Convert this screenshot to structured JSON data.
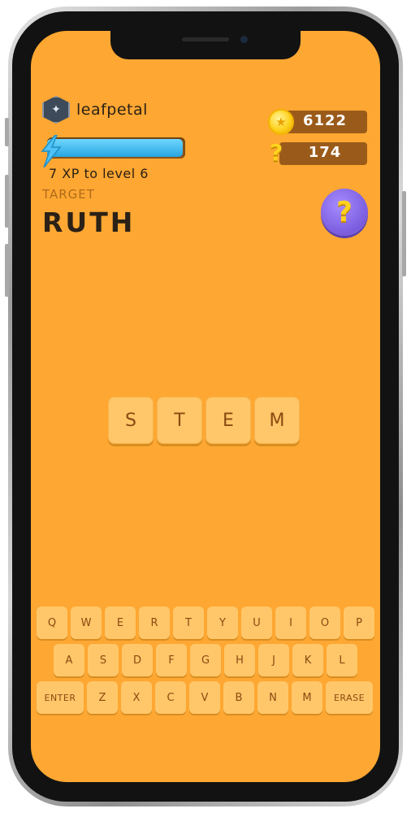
{
  "player": {
    "username": "leafpetal",
    "avatar_icon": "shield-emblem-icon",
    "xp_text": "7 XP to level 6",
    "xp_progress": 0.98
  },
  "currency": {
    "coins": "6122",
    "coin_icon": "star-coin-icon",
    "hints": "174",
    "hint_icon": "question-mark-icon"
  },
  "target": {
    "label": "TARGET",
    "word": "RUTH"
  },
  "help_button": {
    "icon": "question-mark-icon"
  },
  "current_word": [
    "S",
    "T",
    "E",
    "M"
  ],
  "keyboard": {
    "row1": [
      "Q",
      "W",
      "E",
      "R",
      "T",
      "Y",
      "U",
      "I",
      "O",
      "P"
    ],
    "row2": [
      "A",
      "S",
      "D",
      "F",
      "G",
      "H",
      "J",
      "K",
      "L"
    ],
    "row3_enter": "ENTER",
    "row3": [
      "Z",
      "X",
      "C",
      "V",
      "B",
      "N",
      "M"
    ],
    "row3_erase": "ERASE"
  },
  "colors": {
    "background": "#fea732",
    "tile": "#ffc769",
    "tile_text": "#8a4a12",
    "xp_fill": "#28a5e0",
    "help_button": "#7a5cdd"
  }
}
